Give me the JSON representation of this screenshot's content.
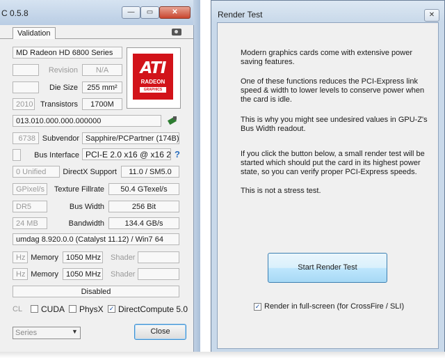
{
  "gpuz": {
    "title": "C 0.5.8",
    "caption_buttons": {
      "minimize": "—",
      "maximize": "▭",
      "close": "✕"
    },
    "tab_validation": "Validation",
    "name_value": "MD Radeon HD 6800 Series",
    "revision_label": "Revision",
    "revision_value": "N/A",
    "diesize_label": "Die Size",
    "diesize_value": "255 mm²",
    "year_value": "2010",
    "transistors_label": "Transistors",
    "transistors_value": "1700M",
    "bios_value": "013.010.000.000.000000",
    "deviceid_value": "6738",
    "subvendor_label": "Subvendor",
    "subvendor_value": "Sapphire/PCPartner (174B)",
    "businterface_label": "Bus Interface",
    "businterface_value": "PCI-E 2.0 x16 @ x16 2.0",
    "help_glyph": "?",
    "shaders_value": "0 Unified",
    "directx_label": "DirectX Support",
    "directx_value": "11.0 / SM5.0",
    "pixel_value": "GPixel/s",
    "texture_label": "Texture Fillrate",
    "texture_value": "50.4 GTexel/s",
    "memtype_value": "DR5",
    "buswidth_label": "Bus Width",
    "buswidth_value": "256 Bit",
    "memsize_value": "24 MB",
    "bandwidth_label": "Bandwidth",
    "bandwidth_value": "134.4 GB/s",
    "driver_value": "umdag 8.920.0.0 (Catalyst 11.12) / Win7 64",
    "mhz1": "Hz",
    "memory_label": "Memory",
    "memory_value1": "1050 MHz",
    "shader_label": "Shader",
    "mhz2": "Hz",
    "memory_value2": "1050 MHz",
    "crossfire_value": "Disabled",
    "opencl_label": "CL",
    "cuda_label": "CUDA",
    "physx_label": "PhysX",
    "directcompute_label": "DirectCompute 5.0",
    "directcompute_check": "✓",
    "gpu_select_value": "Series",
    "close_button": "Close"
  },
  "render_test": {
    "title": "Render Test",
    "close_glyph": "✕",
    "paragraphs": [
      "Modern graphics cards come with extensive power saving features.",
      "One of these functions reduces the PCI-Express link speed & width to lower levels to conserve power when the card is idle.",
      "This is why you might see undesired values in GPU-Z's Bus Width readout.",
      "If you click the button below, a small render test will be started which should put the card in its highest power state, so you can verify proper PCI-Express speeds.",
      "This is not a stress test."
    ],
    "start_button": "Start Render Test",
    "fullscreen_checked": "✓",
    "fullscreen_label": "Render in full-screen (for CrossFire / SLI)"
  }
}
